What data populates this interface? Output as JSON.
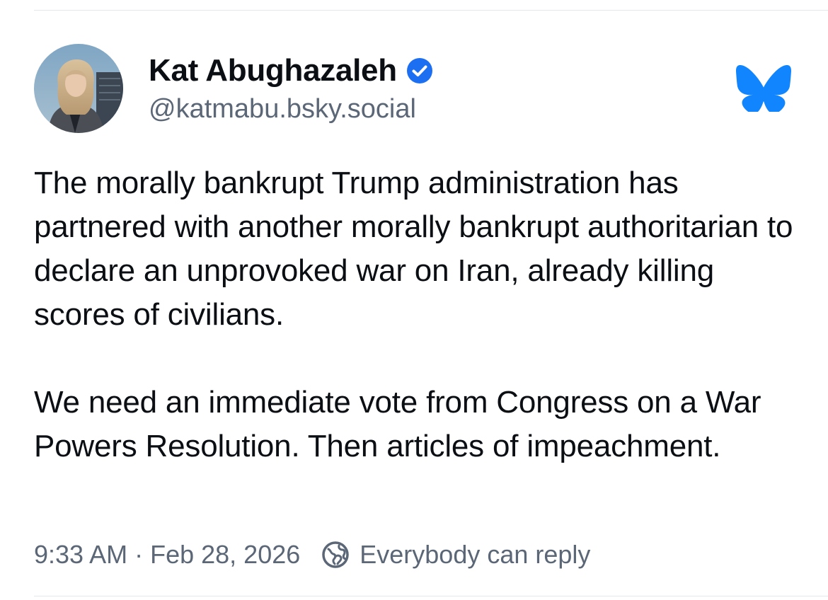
{
  "author": {
    "display_name": "Kat Abughazaleh",
    "handle": "@katmabu.bsky.social",
    "verified": true,
    "avatar_icon": "profile-photo"
  },
  "platform": {
    "logo_icon": "bluesky-butterfly-icon",
    "brand_color": "#1185fe"
  },
  "post": {
    "paragraphs": [
      "The morally bankrupt Trump administration has partnered with another morally bankrupt authoritarian to declare an unprovoked war on Iran, already killing scores of civilians.",
      "We need an immediate vote from Congress on a War Powers Resolution. Then articles of impeachment."
    ]
  },
  "meta": {
    "time": "9:33 AM",
    "separator": "·",
    "date": "Feb 28, 2026",
    "reply_setting_icon": "globe-reply-icon",
    "reply_setting": "Everybody can reply"
  },
  "colors": {
    "text_primary": "#0b0f14",
    "text_secondary": "#5b6776",
    "verified_badge": "#1d6ff2",
    "divider": "#e4e8ec"
  }
}
